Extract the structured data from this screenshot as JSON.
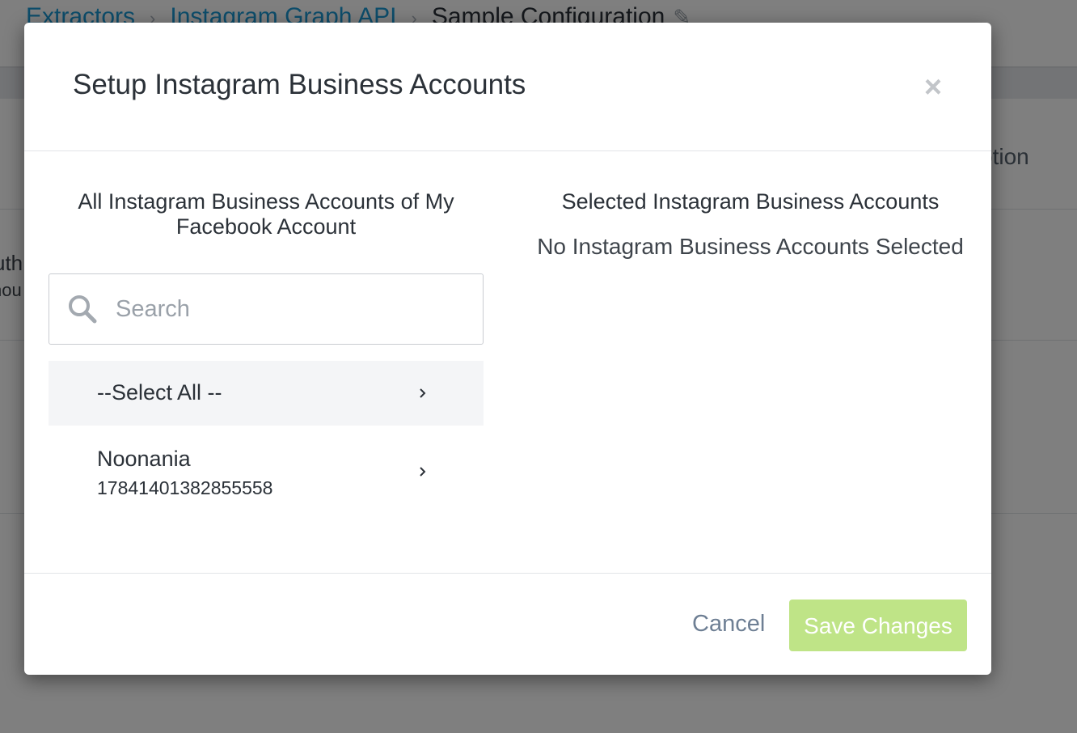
{
  "background": {
    "breadcrumb": [
      "Extractors",
      "Instagram Graph API",
      "Sample Configuration"
    ],
    "breadcrumb_separator": "›",
    "partial_option_text": "otion",
    "partial_left_text_1": "uth",
    "partial_left_text_2": "nou"
  },
  "modal": {
    "title": "Setup Instagram Business Accounts",
    "close_glyph": "×",
    "left": {
      "heading": "All Instagram Business Accounts of My Facebook Account",
      "search_placeholder": "Search",
      "search_value": "",
      "select_all_label": "--Select All --",
      "accounts": [
        {
          "name": "Noonania",
          "id": "17841401382855558"
        }
      ]
    },
    "right": {
      "heading": "Selected Instagram Business Accounts",
      "empty_text": "No Instagram Business Accounts Selected"
    },
    "footer": {
      "cancel_label": "Cancel",
      "save_label": "Save Changes"
    }
  },
  "colors": {
    "link": "#1a9bd7",
    "save_button_disabled": "#bfe487",
    "cancel_text": "#6e7f94"
  },
  "icons": [
    "search-icon",
    "chevron-right-icon",
    "close-icon",
    "pencil-icon"
  ]
}
